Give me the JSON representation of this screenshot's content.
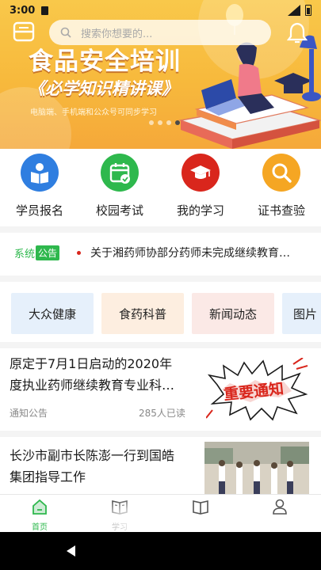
{
  "status_bar": {
    "time": "3:00"
  },
  "header": {
    "search_placeholder": "搜索你想要的..."
  },
  "banner": {
    "title": "食品安全培训",
    "subtitle": "《必学知识精讲课》",
    "caption": "电脑端、手机端和公众号可同步学习",
    "slide_count": 4,
    "active_slide": 4
  },
  "quick_actions": [
    {
      "label": "学员报名",
      "icon": "person-book-icon",
      "color": "#2f7ee0"
    },
    {
      "label": "校园考试",
      "icon": "calendar-check-icon",
      "color": "#2eb84d"
    },
    {
      "label": "我的学习",
      "icon": "graduation-cap-icon",
      "color": "#d9261c"
    },
    {
      "label": "证书查验",
      "icon": "search-icon",
      "color": "#f5a623"
    }
  ],
  "notice": {
    "tag_part1": "系统",
    "tag_part2": "公告",
    "text": "关于湘药师协部分药师未完成继续教育…"
  },
  "categories": [
    {
      "label": "大众健康",
      "bg": "#e6f0fb"
    },
    {
      "label": "食药科普",
      "bg": "#fdeee0"
    },
    {
      "label": "新闻动态",
      "bg": "#fbe9e6"
    },
    {
      "label": "图片",
      "bg": "#e6f0fb"
    }
  ],
  "news": [
    {
      "title_line1": "原定于7月1日启动的2020年",
      "title_line2": "度执业药师继续教育专业科…",
      "source": "通知公告",
      "readers": "285人已读",
      "thumb_text": "重要通知"
    },
    {
      "title_line1": "长沙市副市长陈澎一行到国皓",
      "title_line2": "集团指导工作"
    }
  ],
  "tabbar": [
    {
      "label": "首页",
      "icon": "home-icon",
      "active": true
    },
    {
      "label": "学习",
      "icon": "book-open-icon",
      "active": false
    },
    {
      "label": "",
      "icon": "book-icon",
      "active": false
    },
    {
      "label": "",
      "icon": "user-icon",
      "active": false
    }
  ],
  "colors": {
    "accent": "#2eb84d",
    "banner": "#f7b93c"
  }
}
